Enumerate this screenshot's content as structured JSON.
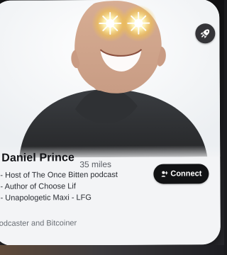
{
  "profile": {
    "name": "Daniel Prince",
    "distance": "35 miles",
    "bio_lines": [
      "- Host of The Once Bitten podcast",
      "- Author of Choose Lif",
      "- Unapologetic Maxi - LFG"
    ],
    "subtitle": "odcaster and Bitcoiner"
  },
  "actions": {
    "connect_label": "Connect",
    "connect_icon": "person-add-icon"
  },
  "photo": {
    "subject_description": "Smiling bald man in dark polo shirt with glowing laser eyes"
  },
  "colors": {
    "card_bg": "#f3f4f6",
    "dark_button": "#111214",
    "text_primary": "#111216",
    "text_secondary": "#5b5f66",
    "badge": "#343438",
    "shirt": "#2f3134",
    "laser_glow": "#fff5cc"
  },
  "icons": {
    "badge_icon": "rocket-icon",
    "connect_icon": "person-add-icon"
  }
}
